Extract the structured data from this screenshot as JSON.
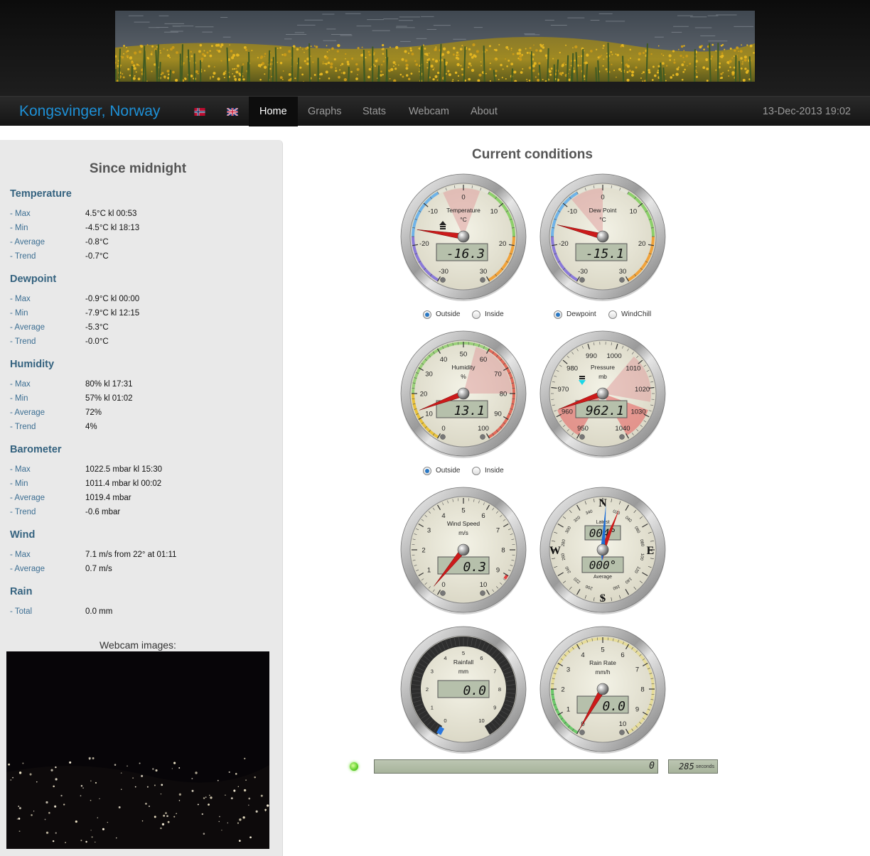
{
  "header": {
    "site_title": "Kongsvinger, Norway",
    "datetime": "13-Dec-2013 19:02"
  },
  "nav": [
    {
      "label": "Home",
      "active": true
    },
    {
      "label": "Graphs",
      "active": false
    },
    {
      "label": "Stats",
      "active": false
    },
    {
      "label": "Webcam",
      "active": false
    },
    {
      "label": "About",
      "active": false
    }
  ],
  "sidebar": {
    "title": "Since midnight",
    "sections": [
      {
        "title": "Temperature",
        "rows": [
          {
            "label": "- Max",
            "value": "4.5°C kl 00:53"
          },
          {
            "label": "- Min",
            "value": "-4.5°C kl 18:13"
          },
          {
            "label": "- Average",
            "value": "-0.8°C"
          },
          {
            "label": "- Trend",
            "value": "-0.7°C"
          }
        ]
      },
      {
        "title": "Dewpoint",
        "rows": [
          {
            "label": "- Max",
            "value": "-0.9°C kl 00:00"
          },
          {
            "label": "- Min",
            "value": "-7.9°C kl 12:15"
          },
          {
            "label": "- Average",
            "value": "-5.3°C"
          },
          {
            "label": "- Trend",
            "value": "-0.0°C"
          }
        ]
      },
      {
        "title": "Humidity",
        "rows": [
          {
            "label": "- Max",
            "value": "80% kl 17:31"
          },
          {
            "label": "- Min",
            "value": "57% kl 01:02"
          },
          {
            "label": "- Average",
            "value": "72%"
          },
          {
            "label": "- Trend",
            "value": "4%"
          }
        ]
      },
      {
        "title": "Barometer",
        "rows": [
          {
            "label": "- Max",
            "value": "1022.5 mbar kl 15:30"
          },
          {
            "label": "- Min",
            "value": "1011.4 mbar kl 00:02"
          },
          {
            "label": "- Average",
            "value": "1019.4 mbar"
          },
          {
            "label": "- Trend",
            "value": "-0.6 mbar"
          }
        ]
      },
      {
        "title": "Wind",
        "rows": [
          {
            "label": "- Max",
            "value": "7.1 m/s from 22° at 01:11"
          },
          {
            "label": "- Average",
            "value": "0.7 m/s"
          }
        ]
      },
      {
        "title": "Rain",
        "rows": [
          {
            "label": "- Total",
            "value": "0.0 mm"
          }
        ]
      }
    ],
    "webcam_title": "Webcam images:"
  },
  "main": {
    "title": "Current conditions",
    "gauges": [
      {
        "id": "temperature",
        "title": "Temperature",
        "unit": "°C",
        "value": -16.3,
        "display": "-16.3",
        "min": -30,
        "max": 30,
        "ticks": [
          "-30",
          "-20",
          "-10",
          "0",
          "10",
          "20",
          "30"
        ],
        "trend": "up"
      },
      {
        "id": "dewpoint",
        "title": "Dew Point",
        "unit": "°C",
        "value": -15.1,
        "display": "-15.1",
        "min": -30,
        "max": 30,
        "ticks": [
          "-30",
          "-20",
          "-10",
          "0",
          "10",
          "20",
          "30"
        ]
      },
      {
        "id": "humidity",
        "title": "Humidity",
        "unit": "%",
        "value": 13.1,
        "display": "13.1",
        "min": 0,
        "max": 100,
        "ticks": [
          "0",
          "10",
          "20",
          "30",
          "40",
          "50",
          "60",
          "70",
          "80",
          "90",
          "100"
        ]
      },
      {
        "id": "pressure",
        "title": "Pressure",
        "unit": "mb",
        "value": 962.1,
        "display": "962.1",
        "min": 950,
        "max": 1040,
        "ticks": [
          "950",
          "960",
          "970",
          "980",
          "990",
          "1000",
          "1010",
          "1020",
          "1030",
          "1040"
        ],
        "trend": "down"
      },
      {
        "id": "windspeed",
        "title": "Wind Speed",
        "unit": "m/s",
        "value": 0.3,
        "display": "0.3",
        "min": 0,
        "max": 10,
        "ticks": [
          "0",
          "1",
          "2",
          "3",
          "4",
          "5",
          "6",
          "7",
          "8",
          "9",
          "10"
        ]
      },
      {
        "id": "winddir",
        "title": "Latest",
        "latest": "004°",
        "average_display": "000°",
        "average_label": "Average",
        "latest_deg": 4,
        "average_deg": 22,
        "cardinals": [
          "N",
          "E",
          "S",
          "W"
        ]
      },
      {
        "id": "rainfall",
        "title": "Rainfall",
        "unit": "mm",
        "value": 0.0,
        "display": "0.0",
        "min": 0,
        "max": 10,
        "ticks": [
          "0",
          "1",
          "2",
          "3",
          "4",
          "5",
          "6",
          "7",
          "8",
          "9",
          "10"
        ]
      },
      {
        "id": "rainrate",
        "title": "Rain Rate",
        "unit": "mm/h",
        "value": 0.0,
        "display": "0.0",
        "min": 0,
        "max": 10,
        "ticks": [
          "0",
          "1",
          "2",
          "3",
          "4",
          "5",
          "6",
          "7",
          "8",
          "9",
          "10"
        ]
      }
    ],
    "radios": {
      "temp": [
        {
          "label": "Outside",
          "checked": true
        },
        {
          "label": "Inside",
          "checked": false
        }
      ],
      "dew": [
        {
          "label": "Dewpoint",
          "checked": true
        },
        {
          "label": "WindChill",
          "checked": false
        }
      ],
      "hum": [
        {
          "label": "Outside",
          "checked": true
        },
        {
          "label": "Inside",
          "checked": false
        }
      ]
    },
    "status": {
      "bar_value": "0",
      "timer_value": "285",
      "timer_unit": "seconds",
      "led_color": "#5fd02a"
    }
  },
  "colors": {
    "title_blue": "#1e90d6",
    "section_blue": "#34627f",
    "needle_red": "#cc1a1a",
    "lcd_bg": "#b6c0ab"
  }
}
